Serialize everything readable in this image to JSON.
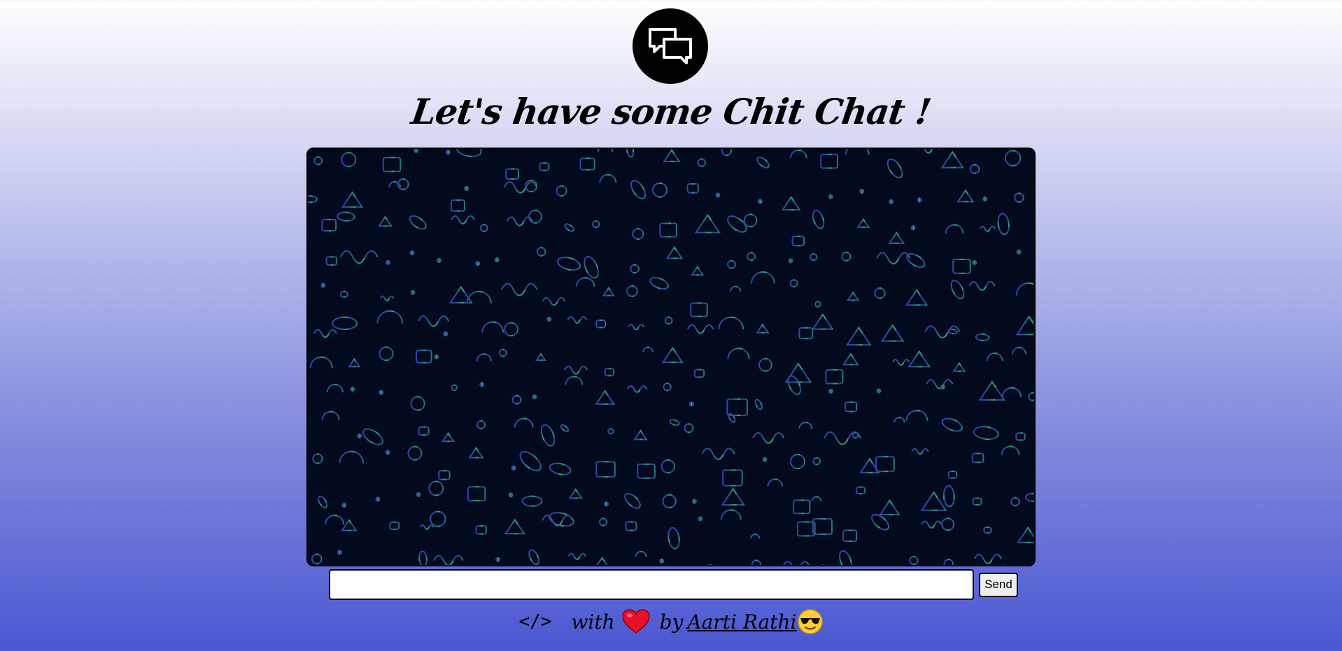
{
  "header": {
    "logo_icon": "chat-bubbles-icon",
    "title": "Let's have some Chit Chat !"
  },
  "chat": {
    "background_pattern": "doodle-pattern",
    "message_input": {
      "value": "",
      "placeholder": ""
    },
    "send_label": "Send"
  },
  "footer": {
    "code_symbol": "</>",
    "with_text": "with",
    "heart_icon": "heart-icon",
    "by_text": "by",
    "author": "Aarti Rathi",
    "emoji_icon": "sunglasses-face-icon"
  },
  "colors": {
    "background_top": "#ffffff",
    "background_bottom": "#4a57d2",
    "chat_background": "#040a1e",
    "pattern_blue": "#3a58c8",
    "pattern_green": "#3fd08a",
    "heart": "#e8102a"
  }
}
